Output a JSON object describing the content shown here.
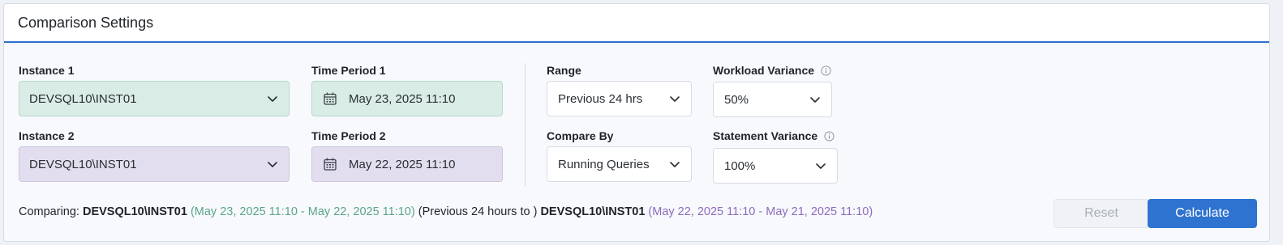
{
  "panel": {
    "title": "Comparison Settings"
  },
  "instance1": {
    "label": "Instance 1",
    "value": "DEVSQL10\\INST01"
  },
  "instance2": {
    "label": "Instance 2",
    "value": "DEVSQL10\\INST01"
  },
  "time_period1": {
    "label": "Time Period 1",
    "value": "May 23, 2025 11:10"
  },
  "time_period2": {
    "label": "Time Period 2",
    "value": "May 22, 2025 11:10"
  },
  "range": {
    "label": "Range",
    "value": "Previous 24 hrs"
  },
  "compare_by": {
    "label": "Compare By",
    "value": "Running Queries"
  },
  "workload_variance": {
    "label": "Workload Variance",
    "value": "50%"
  },
  "statement_variance": {
    "label": "Statement Variance",
    "value": "100%"
  },
  "summary": {
    "prefix": "Comparing: ",
    "instance1": "DEVSQL10\\INST01",
    "period1": " (May 23, 2025 11:10 - May 22, 2025 11:10) ",
    "range_text": "(Previous 24 hours to ) ",
    "instance2": "DEVSQL10\\INST01",
    "period2": " (May 22, 2025 11:10 - May 21, 2025 11:10)"
  },
  "buttons": {
    "reset": "Reset",
    "calculate": "Calculate"
  },
  "colors": {
    "accent": "#2f73d0",
    "instance1_bg": "#d9ece6",
    "instance2_bg": "#e3deef",
    "instance1_text": "#5aa58a",
    "instance2_text": "#8e6bbd"
  },
  "icons": {
    "dropdown": "chevron-down-icon",
    "calendar": "calendar-icon",
    "info": "info-icon"
  }
}
